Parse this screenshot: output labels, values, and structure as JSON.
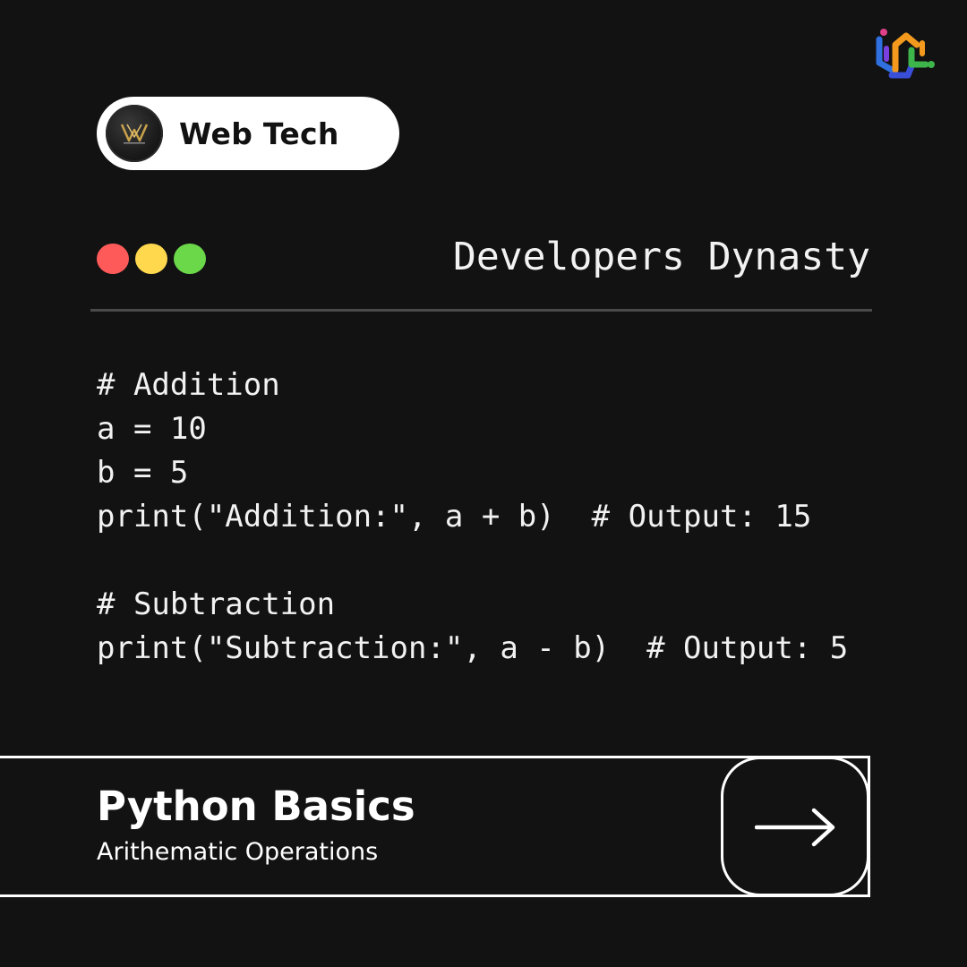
{
  "header": {
    "brand_icon": "logo-icon",
    "channel": {
      "name": "Web Tech",
      "avatar_icon": "web-tech-avatar"
    }
  },
  "window": {
    "title": "Developers Dynasty",
    "controls": [
      {
        "name": "close",
        "color": "#ff5a5a"
      },
      {
        "name": "minimize",
        "color": "#ffd84e"
      },
      {
        "name": "maximize",
        "color": "#6bd84a"
      }
    ]
  },
  "code": {
    "lines": [
      "# Addition",
      "a = 10",
      "b = 5",
      "print(\"Addition:\", a + b)  # Output: 15",
      "",
      "# Subtraction",
      "print(\"Subtraction:\", a - b)  # Output: 5"
    ]
  },
  "footer": {
    "title": "Python Basics",
    "subtitle": "Arithematic Operations",
    "next_icon": "arrow-right-icon"
  },
  "colors": {
    "background": "#121212",
    "text": "#f2f2f2",
    "accent": "#ffffff"
  }
}
